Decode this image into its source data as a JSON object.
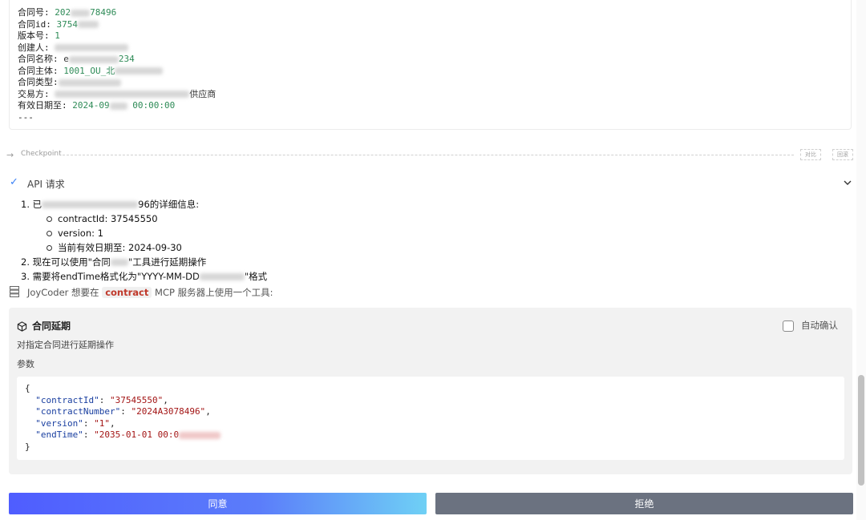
{
  "contract_info": {
    "contract_number_label": "合同号:",
    "contract_number_value_prefix": "202",
    "contract_number_value_suffix": "78496",
    "contract_id_label": "合同id:",
    "contract_id_value_prefix": "3754",
    "version_label": "版本号:",
    "version_value": "1",
    "creator_label": "创建人:",
    "contract_name_label": "合同名称:",
    "contract_name_value_prefix": "e",
    "contract_name_value_suffix": "234",
    "subject_label": "合同主体:",
    "subject_value_prefix": "1001_OU_北",
    "type_label": "合同类型:",
    "counterparty_label": "交易方:",
    "counterparty_value_suffix": "供应商",
    "expiry_label": "有效日期至:",
    "expiry_value_prefix": "2024-09",
    "expiry_value_suffix": "00:00:00",
    "separator": "---"
  },
  "checkpoint": {
    "arrow": "→",
    "label": "Checkpoint",
    "compare_label": "对比",
    "restore_label": "回滚"
  },
  "api_request": {
    "check_icon": "✓",
    "title": "API 请求"
  },
  "steps": {
    "step1_prefix": "1. 已",
    "step1_suffix": "96的详细信息:",
    "contract_id_line": "contractId: 37545550",
    "version_line": "version: 1",
    "expiry_line": "当前有效日期至: 2024-09-30",
    "step2_prefix": "2. 现在可以使用\"合同",
    "step2_suffix": "\"工具进行延期操作",
    "step3_prefix": "3. 需要将endTime格式化为\"YYYY-MM-DD",
    "step3_suffix": "\"格式"
  },
  "mcp": {
    "prefix": "JoyCoder 想要在",
    "server_tag": "contract",
    "suffix": "MCP 服务器上使用一个工具:"
  },
  "tool": {
    "name": "合同延期",
    "auto_confirm_label": "自动确认",
    "description": "对指定合同进行延期操作",
    "params_label": "参数",
    "json": {
      "open": "{",
      "close": "}",
      "contractId_key": "\"contractId\"",
      "contractId_val": "\"37545550\"",
      "contractNumber_key": "\"contractNumber\"",
      "contractNumber_val": "\"2024A3078496\"",
      "version_key": "\"version\"",
      "version_val": "\"1\"",
      "endTime_key": "\"endTime\"",
      "endTime_val": "\"2035-01-01 00:0"
    }
  },
  "actions": {
    "approve_label": "同意",
    "reject_label": "拒绝"
  },
  "colors": {
    "accent_blue": "#4f5dff",
    "reject_gray": "#6b7280",
    "server_tag_red": "#c0392b"
  }
}
